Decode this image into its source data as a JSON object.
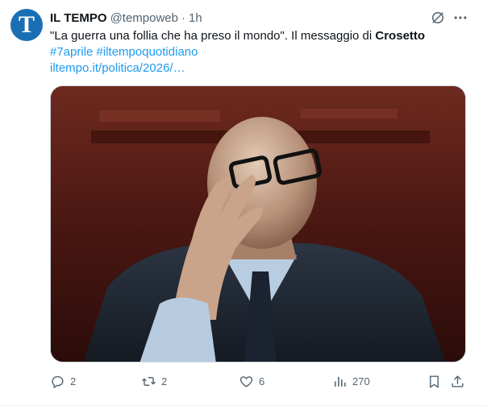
{
  "author": {
    "avatar_letter": "T",
    "name": "IL TEMPO",
    "handle": "@tempoweb",
    "separator": "·",
    "time": "1h"
  },
  "post": {
    "text_before": "\"La guerra una follia che ha preso il mondo\". Il messaggio di ",
    "text_bold": "Crosetto",
    "hashtags": "#7aprile #iltempoquotidiano",
    "link": "iltempo.it/politica/2026/…"
  },
  "actions": {
    "replies": "2",
    "reposts": "2",
    "likes": "6",
    "views": "270"
  },
  "icons": {
    "avatar": "il-tempo-logo",
    "grok": "grok-icon",
    "more": "more-icon",
    "reply": "reply-icon",
    "repost": "repost-icon",
    "like": "heart-icon",
    "views": "views-icon",
    "bookmark": "bookmark-icon",
    "share": "share-icon"
  },
  "colors": {
    "link": "#1d9bf0",
    "secondary_text": "#536471",
    "avatar_bg": "#1a6fb4"
  }
}
